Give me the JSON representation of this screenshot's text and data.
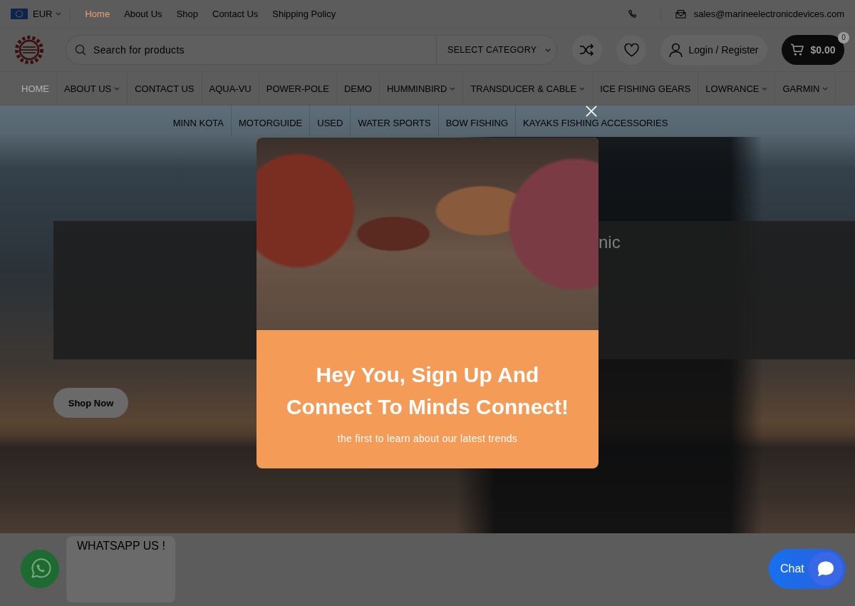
{
  "top_bar": {
    "currency": "EUR",
    "links": [
      {
        "label": "Home",
        "selected": true
      },
      {
        "label": "About Us",
        "selected": false
      },
      {
        "label": "Shop",
        "selected": false
      },
      {
        "label": "Contact Us",
        "selected": false
      },
      {
        "label": "Shipping Policy",
        "selected": false
      }
    ],
    "email": "sales@marineelectronicdevices.com"
  },
  "header": {
    "search": {
      "placeholder": "Search for products"
    },
    "category_select": "SELECT CATEGORY",
    "account": "Login / Register",
    "cart": {
      "total": "$0.00",
      "count": "0"
    }
  },
  "nav": {
    "items": [
      {
        "label": "HOME",
        "selected": true,
        "dropdown": false
      },
      {
        "label": "ABOUT US",
        "selected": false,
        "dropdown": true
      },
      {
        "label": "CONTACT US",
        "selected": false,
        "dropdown": false
      },
      {
        "label": "AQUA-VU",
        "selected": false,
        "dropdown": false
      },
      {
        "label": "POWER-POLE",
        "selected": false,
        "dropdown": false
      },
      {
        "label": "DEMO",
        "selected": false,
        "dropdown": false
      },
      {
        "label": "HUMMINBIRD",
        "selected": false,
        "dropdown": true
      },
      {
        "label": "TRANSDUCER & CABLE",
        "selected": false,
        "dropdown": true
      },
      {
        "label": "ICE FISHING GEARS",
        "selected": false,
        "dropdown": false
      },
      {
        "label": "LOWRANCE",
        "selected": false,
        "dropdown": true
      },
      {
        "label": "GARMIN",
        "selected": false,
        "dropdown": true
      }
    ]
  },
  "subnav": {
    "items": [
      "MINN KOTA",
      "MOTORGUIDE",
      "USED",
      "WATER SPORTS",
      "BOW FISHING",
      "KAYAKS FISHING ACCESSORIES"
    ]
  },
  "hero": {
    "title": "nic",
    "button": "Shop Now"
  },
  "popup": {
    "heading": "Hey You, Sign Up And Connect To Minds Connect!",
    "subtitle": "the first to learn about our latest trends"
  },
  "whatsapp": {
    "label": "WHATSAPP US !"
  },
  "chat": {
    "label": "Chat"
  }
}
